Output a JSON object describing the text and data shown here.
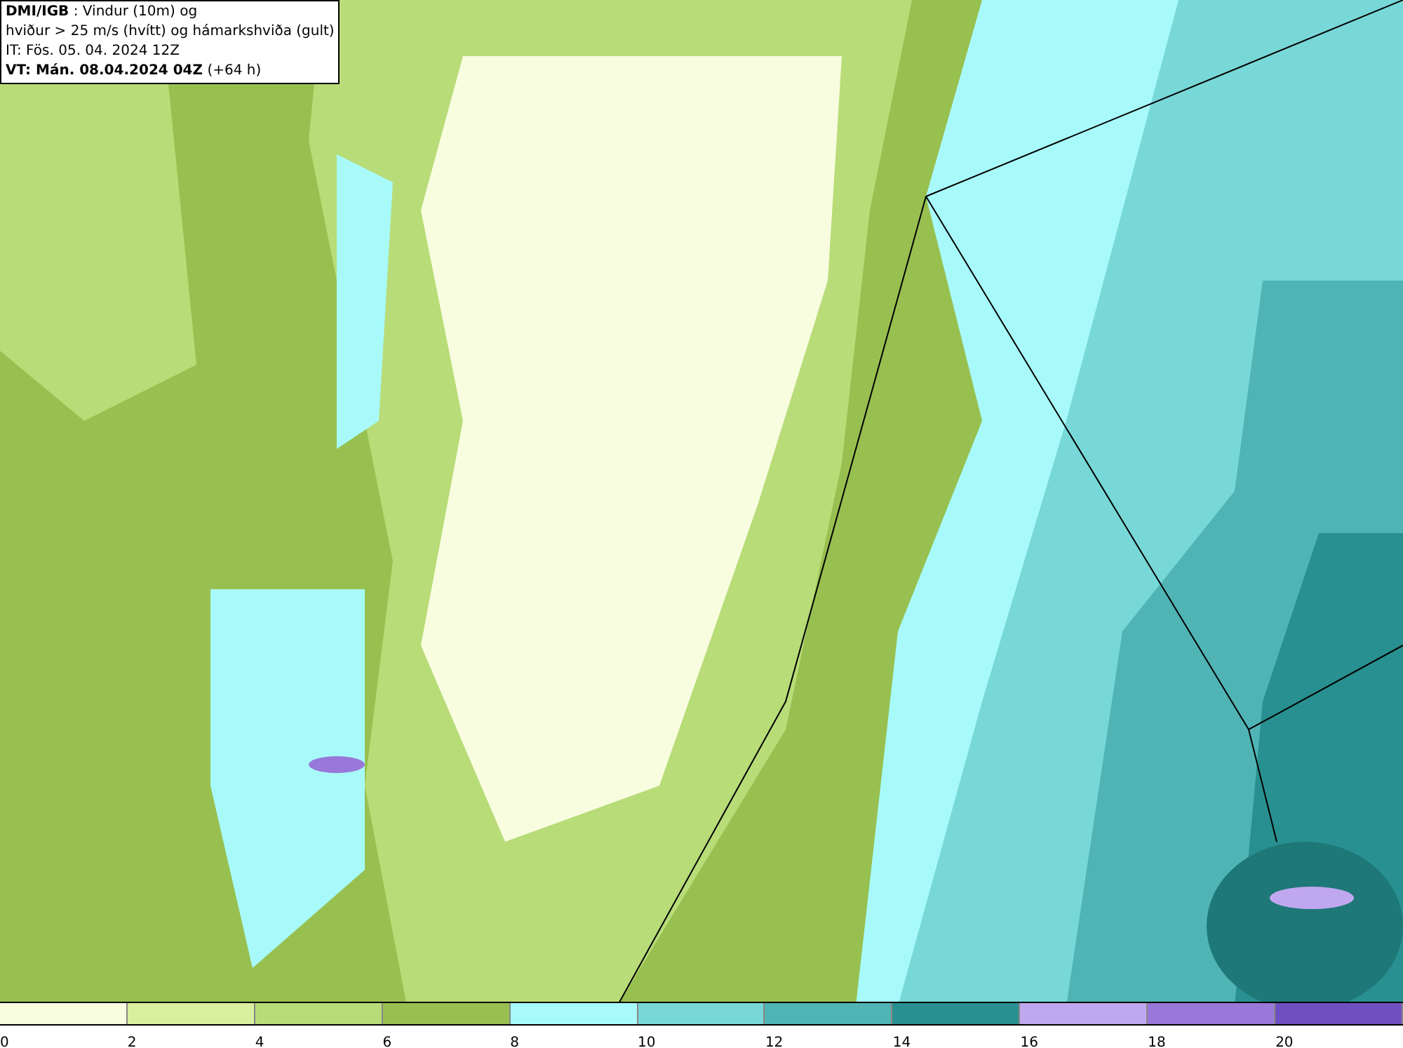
{
  "header": {
    "lines": [
      "**DMI/IGB** : Vindur (10m) og",
      "hviður > 25 m/s (hvítt) og hámarkshviða (gult)",
      "IT: Fös. 05. 04. 2024 12Z",
      "**VT: Mán. 08.04.2024 04Z** (+64 h)"
    ]
  },
  "legend": {
    "bins": [
      {
        "color": "#f8fde0",
        "label": "0"
      },
      {
        "color": "#d8f0a0",
        "label": "2"
      },
      {
        "color": "#b8dc78",
        "label": "4"
      },
      {
        "color": "#98c050",
        "label": "6"
      },
      {
        "color": "#a8fafa",
        "label": "8"
      },
      {
        "color": "#78d8d8",
        "label": "10"
      },
      {
        "color": "#50b4b4",
        "label": "12"
      },
      {
        "color": "#289090",
        "label": "14"
      },
      {
        "color": "#c0a8f0",
        "label": "16"
      },
      {
        "color": "#9878d8",
        "label": "18"
      },
      {
        "color": "#7050c0",
        "label": "20"
      }
    ]
  }
}
